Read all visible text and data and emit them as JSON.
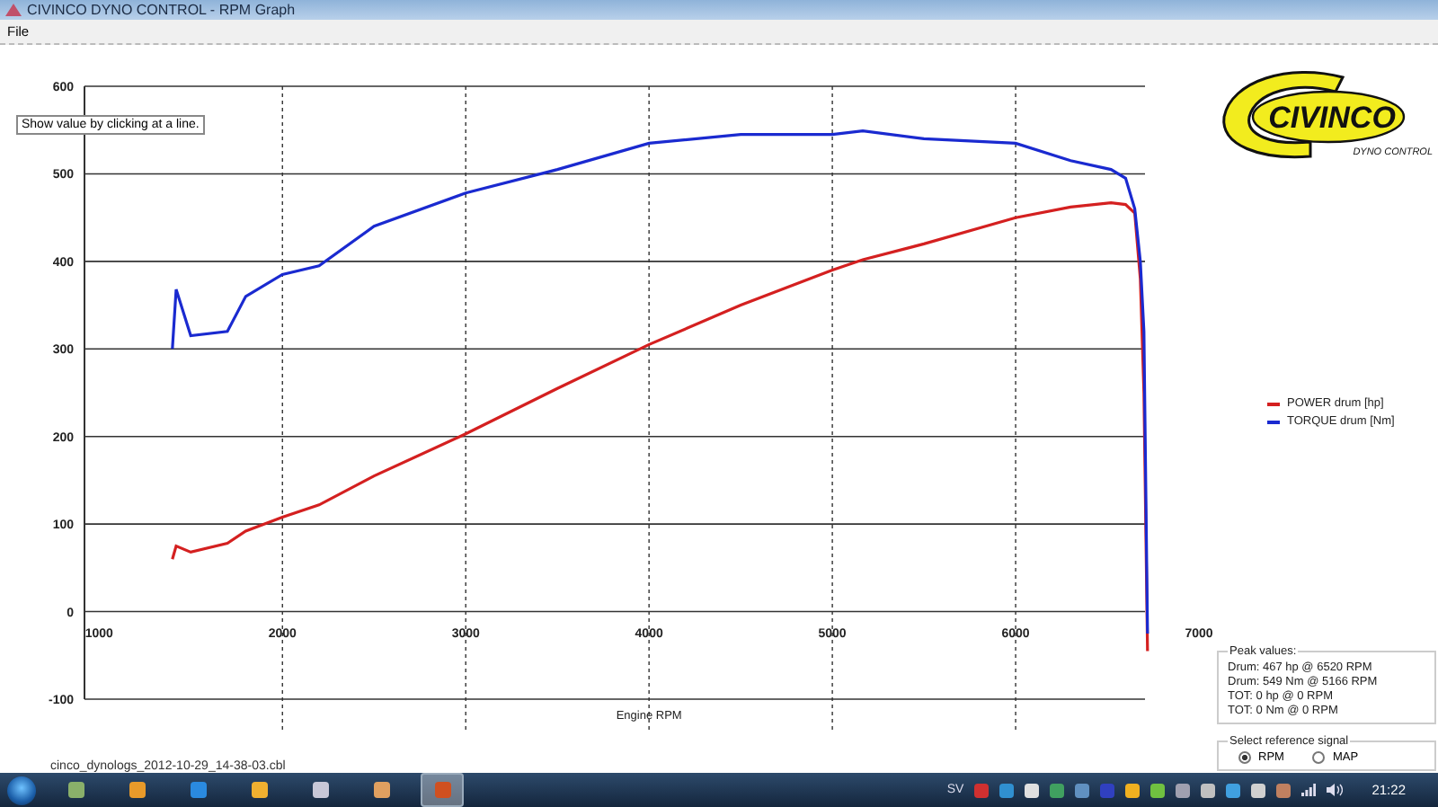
{
  "window": {
    "title": "CIVINCO DYNO CONTROL - RPM Graph"
  },
  "menu": [
    "File"
  ],
  "hint": "Show value by clicking at a line.",
  "chart": {
    "chart_data": {
      "type": "line",
      "grid": true,
      "xlabel": "Engine RPM",
      "xlim": [
        920,
        7000
      ],
      "ylim": [
        -100,
        600
      ],
      "xticks": [
        1000,
        2000,
        3000,
        4000,
        5000,
        6000,
        7000
      ],
      "yticks": [
        -100,
        0,
        100,
        200,
        300,
        400,
        500,
        600
      ],
      "x": [
        1400,
        1420,
        1500,
        1700,
        1800,
        2000,
        2200,
        2500,
        3000,
        3500,
        4000,
        4500,
        5000,
        5166,
        5500,
        6000,
        6300,
        6520,
        6600,
        6650,
        6680,
        6700,
        6720
      ],
      "series": [
        {
          "name": "POWER drum [hp]",
          "color": "#d42020",
          "values": [
            60,
            75,
            68,
            78,
            92,
            108,
            122,
            155,
            203,
            255,
            305,
            350,
            390,
            402,
            420,
            450,
            462,
            467,
            465,
            455,
            380,
            250,
            -45
          ]
        },
        {
          "name": "TORQUE drum [Nm]",
          "color": "#1a2ad0",
          "values": [
            300,
            368,
            315,
            320,
            360,
            385,
            395,
            440,
            478,
            505,
            535,
            545,
            545,
            549,
            540,
            535,
            515,
            505,
            495,
            460,
            400,
            320,
            -25
          ]
        }
      ]
    }
  },
  "logo": {
    "name": "CIVINCO",
    "tagline": "DYNO CONTROL"
  },
  "peak": {
    "title": "Peak values:",
    "lines": [
      "Drum: 467 hp @ 6520 RPM",
      "Drum: 549 Nm @ 5166 RPM",
      "TOT: 0 hp @ 0 RPM",
      "TOT: 0 Nm @ 0 RPM"
    ]
  },
  "reference": {
    "title": "Select reference signal",
    "options": [
      {
        "label": "RPM",
        "selected": true
      },
      {
        "label": "MAP",
        "selected": false
      }
    ]
  },
  "file_name": "cinco_dynologs_2012-10-29_14-38-03.cbl",
  "taskbar": {
    "apps": [
      {
        "selected": false
      },
      {
        "selected": false
      },
      {
        "selected": false
      },
      {
        "selected": false
      },
      {
        "selected": false
      },
      {
        "selected": false
      },
      {
        "selected": true
      }
    ],
    "language": "SV",
    "clock": "21:22"
  }
}
